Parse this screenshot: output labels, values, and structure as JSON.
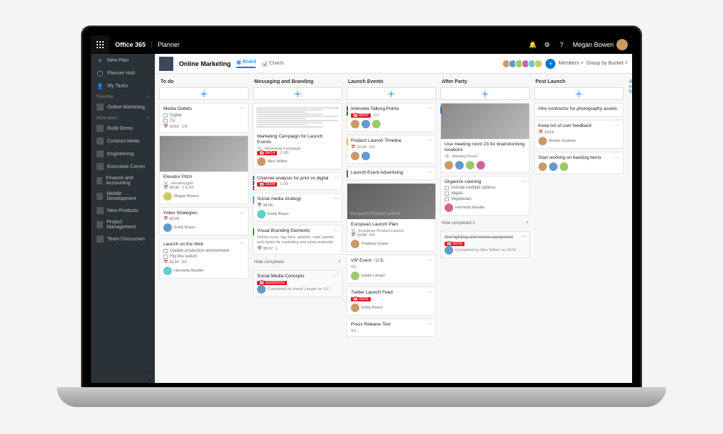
{
  "topbar": {
    "brand": "Office 365",
    "app": "Planner",
    "user": "Megan Bowen"
  },
  "sidebar": {
    "new_plan": "New Plan",
    "planner_hub": "Planner Hub",
    "my_tasks": "My Tasks",
    "favorites_hdr": "Favorites",
    "favorites": [
      "Online Marketing"
    ],
    "more_hdr": "More plans",
    "more": [
      "Build Demo",
      "Contoso News",
      "Engineering",
      "Executive Corner",
      "Finance and Accounting",
      "Mobile Development",
      "New Products",
      "Project Management",
      "Team Discussion"
    ]
  },
  "plan": {
    "title": "Online Marketing",
    "tab_board": "Board",
    "tab_charts": "Charts",
    "members_label": "Members",
    "group_label": "Group by Bucket"
  },
  "buckets": [
    {
      "name": "To do",
      "cards": [
        {
          "title": "Media Outlets",
          "checks": [
            "Digital",
            "TV"
          ],
          "date": "10/16",
          "counts": "1/8",
          "assignees": []
        },
        {
          "img": true,
          "img_label": "Elevator Pitch",
          "title": "Elevator Pitch",
          "attach": "elevator.pptx",
          "date": "06:00",
          "counts": "2  8  0/6",
          "person": "Megan Bowen"
        },
        {
          "title": "Video Strategies",
          "date": "06:09",
          "person": "Emily Braun"
        },
        {
          "title": "Launch on the Web",
          "checks": [
            "Update production environment",
            "Flip the switch"
          ],
          "date": "11/16",
          "counts": "0/2",
          "person": "Henrietta Mueller"
        }
      ]
    },
    {
      "name": "Messaging and Branding",
      "cards": [
        {
          "doc": true,
          "title": "Marketing Campaign for Launch Events",
          "attach": "Marketing Campaign",
          "date_badge": "04/14",
          "counts": "2  0/5",
          "person": "Alex Wilber"
        },
        {
          "title": "Channel analysis for print vs digital",
          "date_badge": "03/04",
          "counts": "1  0/5",
          "stripes": [
            "st-b",
            "st-g",
            "st-r"
          ]
        },
        {
          "title": "Social media strategy",
          "date": "08:05",
          "person": "Emily Braun",
          "stripe": "st-c"
        },
        {
          "title": "Visual Branding Elements",
          "desc": "Define icons, tag lines, artwork, color palette and styles for marketing and sales materials",
          "date": "08:07",
          "counts": "1",
          "stripe": "st-p"
        }
      ],
      "hide_completed": "Hide completed",
      "completed": {
        "title": "Social Media Concepts",
        "date_badge": "10/20/2016",
        "by": "Completed by Isaiah Langer on 12/..."
      }
    },
    {
      "name": "Launch Events",
      "cards": [
        {
          "title": "Interview Talking Points",
          "date_badge": "05/07",
          "counts": "1/1",
          "stripes": [
            "st-r",
            "st-g"
          ],
          "avatars": 3
        },
        {
          "title": "Product Launch Timeline",
          "date": "10:00",
          "counts": "0/3",
          "avatars": 2,
          "stripe": "st-y"
        },
        {
          "title": "Launch Event Advertising",
          "stripe": "st-b"
        },
        {
          "img": true,
          "img_dark": true,
          "img_title": "European Product Launch",
          "title": "European Launch Plan",
          "attach": "European Product Launch",
          "date": "10:09",
          "counts": "0/4",
          "person": "Pradeep Gupta"
        },
        {
          "title": "VIP Event - U.S.",
          "counts": "0/1",
          "person": "Isaiah Langer"
        },
        {
          "title": "Twitter Launch Feed",
          "date_badge": "03/01",
          "person": "Emily Braun"
        },
        {
          "title": "Press Release Text",
          "counts": "0/1"
        }
      ]
    },
    {
      "name": "After Party",
      "cards": [
        {
          "img": true,
          "title": "Use meeting room 23 for brainstorming locations",
          "attach": "Meeting Room",
          "avatars": 4,
          "stripe": "st-b"
        },
        {
          "title": "Organize catering",
          "checks": [
            "Include multiple options",
            "Vegan",
            "Vegetarian"
          ],
          "person": "Henrietta Mueller"
        }
      ],
      "hide_completed": "Hide completed   1",
      "completed": {
        "title": "Get lighting and music equipment",
        "strike": true,
        "date_badge": "02/15",
        "by": "Completed by Alex Wilber on 03/16"
      }
    },
    {
      "name": "Post Launch",
      "cards": [
        {
          "title": "Hire contractor for photography assets"
        },
        {
          "title": "Keep list of user feedback",
          "date": "10/16",
          "person": "Miriam Graham"
        },
        {
          "title": "Start working on backlog items",
          "avatars": 3
        }
      ]
    }
  ],
  "add_bucket": "Add new bu"
}
